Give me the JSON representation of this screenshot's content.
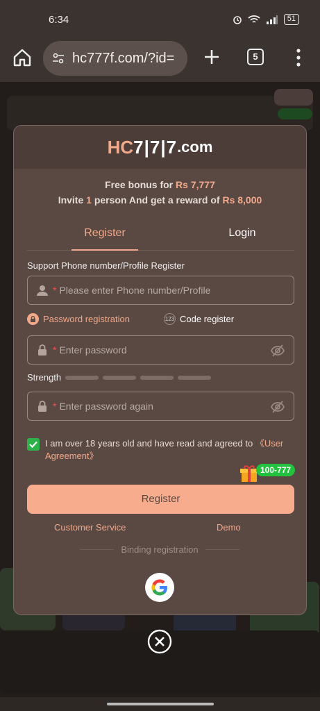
{
  "status": {
    "time": "6:34",
    "battery": "51"
  },
  "browser": {
    "url": "hc777f.com/?id=",
    "tab_count": "5"
  },
  "logo": {
    "hc": "HC",
    "digits": "7|7|7",
    "tld": ".com"
  },
  "bonus": {
    "line1_prefix": "Free bonus for ",
    "line1_amount": "Rs 7,777",
    "line2_prefix": "Invite ",
    "line2_count": "1",
    "line2_mid": " person And get a reward of ",
    "line2_amount": "Rs 8,000"
  },
  "tabs": {
    "register": "Register",
    "login": "Login"
  },
  "form": {
    "section_label": "Support Phone number/Profile Register",
    "phone_placeholder": "Please enter Phone number/Profile",
    "password_option": "Password registration",
    "code_option": "Code register",
    "code_icon": "123",
    "password_placeholder": "Enter password",
    "strength_label": "Strength",
    "confirm_placeholder": "Enter password again",
    "required_mark": "*"
  },
  "agreement": {
    "text": "I am over 18 years old and have read and agreed to ",
    "link": "《User Agreement》",
    "checked": true
  },
  "promo_badge": "100-777",
  "register_button": "Register",
  "links": {
    "customer_service": "Customer Service",
    "demo": "Demo"
  },
  "binding_label": "Binding registration",
  "colors": {
    "accent": "#f2a98a",
    "modal": "#5a4843",
    "check": "#2bb34a"
  }
}
